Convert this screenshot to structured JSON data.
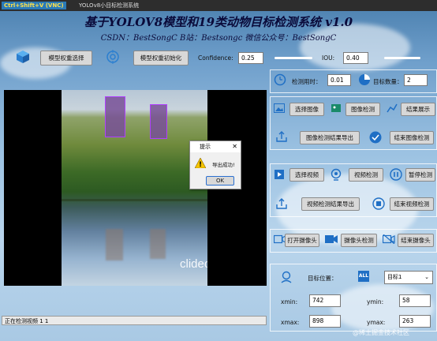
{
  "titlebar": {
    "app_badge": "Ctrl+Shift+V (VNC)",
    "title": "YOLOv8小目标检测系统"
  },
  "header": {
    "title": "基于YOLOV8模型和19类动物目标检测系统 v1.0",
    "subtitle": "CSDN：BestSongC   B站：Bestsongc   微信公众号：BestSongC"
  },
  "toolbar": {
    "model_select": "模型权重选择",
    "model_init": "模型权重初始化",
    "conf_label": "Confidence:",
    "conf_value": "0.25",
    "iou_label": "IOU:",
    "iou_value": "0.40"
  },
  "stats": {
    "time_label": "检测用时：",
    "time_value": "0.01",
    "count_label": "目标数量：",
    "count_value": "2"
  },
  "image_panel": {
    "select": "选择图像",
    "detect": "图像检测",
    "show": "结果展示",
    "export": "图像检测结果导出",
    "end": "结束图像检测"
  },
  "video_panel": {
    "select": "选择视频",
    "detect": "视频检测",
    "pause": "暂停检测",
    "export": "视频检测结果导出",
    "end": "结束视频检测"
  },
  "camera_panel": {
    "open": "打开摄像头",
    "detect": "摄像头检测",
    "end": "结束摄像头"
  },
  "position": {
    "label": "目标位置：",
    "badge": "ALL",
    "selected": "目标1",
    "xmin_label": "xmin:",
    "xmin": "742",
    "ymin_label": "ymin:",
    "ymin": "58",
    "xmax_label": "xmax:",
    "xmax": "898",
    "ymax_label": "ymax:",
    "ymax": "263"
  },
  "dialog": {
    "title": "提示",
    "message": "导出成功!",
    "ok": "OK"
  },
  "watermark": {
    "video": "clideo.com",
    "corner": "@稀土掘金技术社区"
  },
  "status": {
    "text": "正在检测视频 1 1"
  }
}
